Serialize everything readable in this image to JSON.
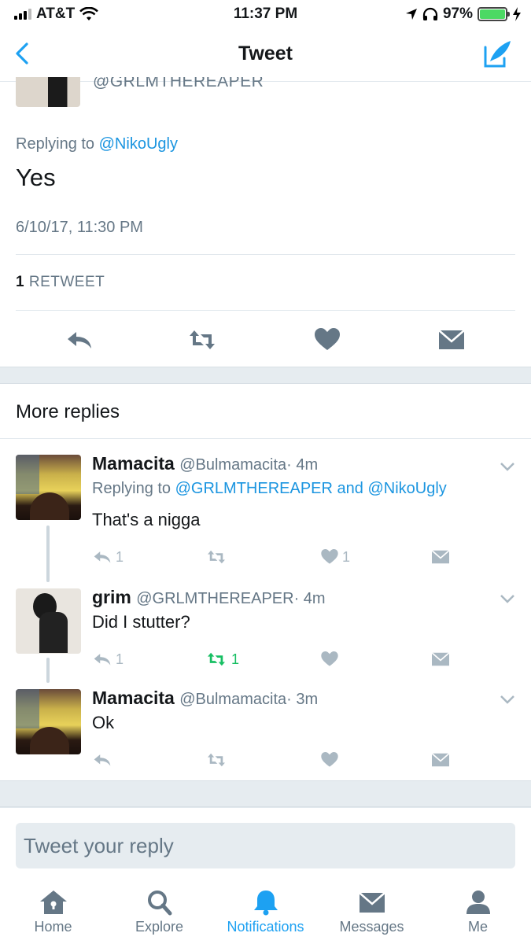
{
  "status_bar": {
    "carrier": "AT&T",
    "time": "11:37 PM",
    "battery_percent": "97%"
  },
  "nav": {
    "title": "Tweet"
  },
  "main_tweet": {
    "handle_partial": "@GRLMTHEREAPER",
    "replying_prefix": "Replying to",
    "replying_to": "@NikoUgly",
    "text": "Yes",
    "timestamp": "6/10/17, 11:30 PM",
    "retweet_count": "1",
    "retweet_label": "RETWEET"
  },
  "more_replies": {
    "title": "More replies",
    "replies": [
      {
        "name": "Mamacita",
        "handle": "@Bulmamacita",
        "time": "· 4m",
        "replying_prefix": "Replying to",
        "replying_to_1": "@GRLMTHEREAPER",
        "replying_and": "and",
        "replying_to_2": "@NikoUgly",
        "text": "That's a nigga",
        "reply_count": "1",
        "retweet_count": "",
        "like_count": "1"
      },
      {
        "name": "grim",
        "handle": "@GRLMTHEREAPER",
        "time": "· 4m",
        "text": "Did I stutter?",
        "reply_count": "1",
        "retweet_count": "1",
        "like_count": ""
      },
      {
        "name": "Mamacita",
        "handle": "@Bulmamacita",
        "time": "· 3m",
        "text": "Ok",
        "reply_count": "",
        "retweet_count": "",
        "like_count": ""
      }
    ]
  },
  "composer": {
    "placeholder": "Tweet your reply"
  },
  "tabs": [
    {
      "label": "Home",
      "icon": "home-icon"
    },
    {
      "label": "Explore",
      "icon": "search-icon"
    },
    {
      "label": "Notifications",
      "icon": "bell-icon"
    },
    {
      "label": "Messages",
      "icon": "envelope-icon"
    },
    {
      "label": "Me",
      "icon": "person-icon"
    }
  ],
  "colors": {
    "link": "#1b95e0",
    "active_tab": "#1da1f2",
    "retweeted": "#17bf63",
    "secondary_text": "#657786",
    "icon_gray": "#aab8c2",
    "action_icon_dark": "#657786"
  }
}
